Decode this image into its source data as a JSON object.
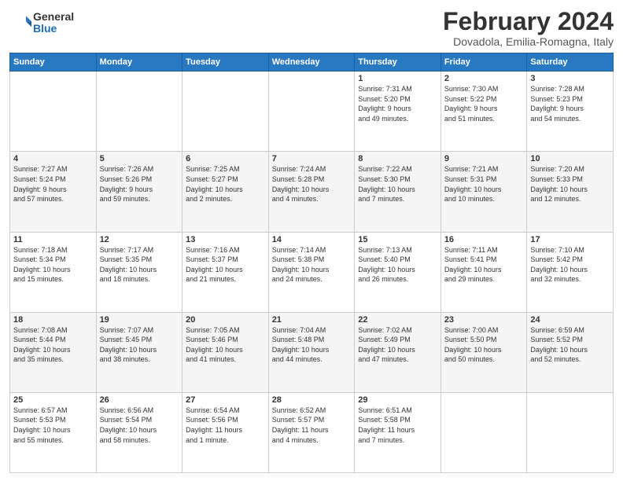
{
  "header": {
    "logo": {
      "general": "General",
      "blue": "Blue"
    },
    "title": "February 2024",
    "location": "Dovadola, Emilia-Romagna, Italy"
  },
  "weekdays": [
    "Sunday",
    "Monday",
    "Tuesday",
    "Wednesday",
    "Thursday",
    "Friday",
    "Saturday"
  ],
  "weeks": [
    [
      {
        "day": "",
        "info": ""
      },
      {
        "day": "",
        "info": ""
      },
      {
        "day": "",
        "info": ""
      },
      {
        "day": "",
        "info": ""
      },
      {
        "day": "1",
        "info": "Sunrise: 7:31 AM\nSunset: 5:20 PM\nDaylight: 9 hours\nand 49 minutes."
      },
      {
        "day": "2",
        "info": "Sunrise: 7:30 AM\nSunset: 5:22 PM\nDaylight: 9 hours\nand 51 minutes."
      },
      {
        "day": "3",
        "info": "Sunrise: 7:28 AM\nSunset: 5:23 PM\nDaylight: 9 hours\nand 54 minutes."
      }
    ],
    [
      {
        "day": "4",
        "info": "Sunrise: 7:27 AM\nSunset: 5:24 PM\nDaylight: 9 hours\nand 57 minutes."
      },
      {
        "day": "5",
        "info": "Sunrise: 7:26 AM\nSunset: 5:26 PM\nDaylight: 9 hours\nand 59 minutes."
      },
      {
        "day": "6",
        "info": "Sunrise: 7:25 AM\nSunset: 5:27 PM\nDaylight: 10 hours\nand 2 minutes."
      },
      {
        "day": "7",
        "info": "Sunrise: 7:24 AM\nSunset: 5:28 PM\nDaylight: 10 hours\nand 4 minutes."
      },
      {
        "day": "8",
        "info": "Sunrise: 7:22 AM\nSunset: 5:30 PM\nDaylight: 10 hours\nand 7 minutes."
      },
      {
        "day": "9",
        "info": "Sunrise: 7:21 AM\nSunset: 5:31 PM\nDaylight: 10 hours\nand 10 minutes."
      },
      {
        "day": "10",
        "info": "Sunrise: 7:20 AM\nSunset: 5:33 PM\nDaylight: 10 hours\nand 12 minutes."
      }
    ],
    [
      {
        "day": "11",
        "info": "Sunrise: 7:18 AM\nSunset: 5:34 PM\nDaylight: 10 hours\nand 15 minutes."
      },
      {
        "day": "12",
        "info": "Sunrise: 7:17 AM\nSunset: 5:35 PM\nDaylight: 10 hours\nand 18 minutes."
      },
      {
        "day": "13",
        "info": "Sunrise: 7:16 AM\nSunset: 5:37 PM\nDaylight: 10 hours\nand 21 minutes."
      },
      {
        "day": "14",
        "info": "Sunrise: 7:14 AM\nSunset: 5:38 PM\nDaylight: 10 hours\nand 24 minutes."
      },
      {
        "day": "15",
        "info": "Sunrise: 7:13 AM\nSunset: 5:40 PM\nDaylight: 10 hours\nand 26 minutes."
      },
      {
        "day": "16",
        "info": "Sunrise: 7:11 AM\nSunset: 5:41 PM\nDaylight: 10 hours\nand 29 minutes."
      },
      {
        "day": "17",
        "info": "Sunrise: 7:10 AM\nSunset: 5:42 PM\nDaylight: 10 hours\nand 32 minutes."
      }
    ],
    [
      {
        "day": "18",
        "info": "Sunrise: 7:08 AM\nSunset: 5:44 PM\nDaylight: 10 hours\nand 35 minutes."
      },
      {
        "day": "19",
        "info": "Sunrise: 7:07 AM\nSunset: 5:45 PM\nDaylight: 10 hours\nand 38 minutes."
      },
      {
        "day": "20",
        "info": "Sunrise: 7:05 AM\nSunset: 5:46 PM\nDaylight: 10 hours\nand 41 minutes."
      },
      {
        "day": "21",
        "info": "Sunrise: 7:04 AM\nSunset: 5:48 PM\nDaylight: 10 hours\nand 44 minutes."
      },
      {
        "day": "22",
        "info": "Sunrise: 7:02 AM\nSunset: 5:49 PM\nDaylight: 10 hours\nand 47 minutes."
      },
      {
        "day": "23",
        "info": "Sunrise: 7:00 AM\nSunset: 5:50 PM\nDaylight: 10 hours\nand 50 minutes."
      },
      {
        "day": "24",
        "info": "Sunrise: 6:59 AM\nSunset: 5:52 PM\nDaylight: 10 hours\nand 52 minutes."
      }
    ],
    [
      {
        "day": "25",
        "info": "Sunrise: 6:57 AM\nSunset: 5:53 PM\nDaylight: 10 hours\nand 55 minutes."
      },
      {
        "day": "26",
        "info": "Sunrise: 6:56 AM\nSunset: 5:54 PM\nDaylight: 10 hours\nand 58 minutes."
      },
      {
        "day": "27",
        "info": "Sunrise: 6:54 AM\nSunset: 5:56 PM\nDaylight: 11 hours\nand 1 minute."
      },
      {
        "day": "28",
        "info": "Sunrise: 6:52 AM\nSunset: 5:57 PM\nDaylight: 11 hours\nand 4 minutes."
      },
      {
        "day": "29",
        "info": "Sunrise: 6:51 AM\nSunset: 5:58 PM\nDaylight: 11 hours\nand 7 minutes."
      },
      {
        "day": "",
        "info": ""
      },
      {
        "day": "",
        "info": ""
      }
    ]
  ]
}
